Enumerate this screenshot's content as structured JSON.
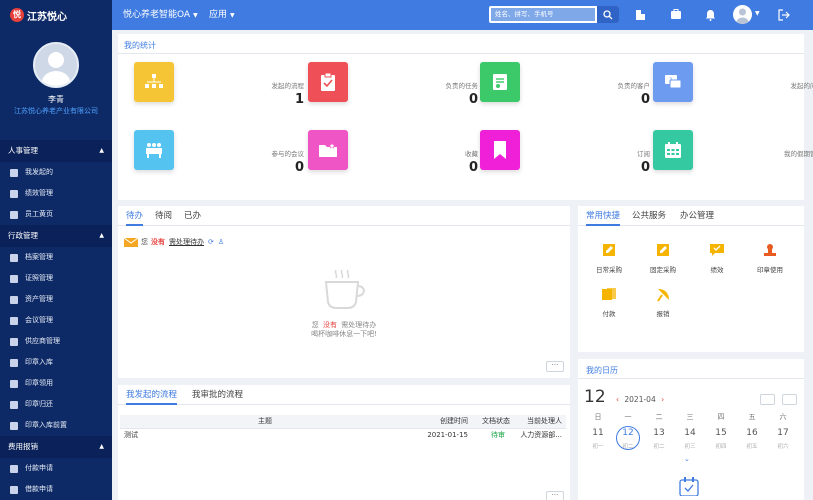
{
  "app": {
    "logo_text": "江苏悦心",
    "logo_mark": "悦"
  },
  "topbar": {
    "menu_oa": "悦心养老智能OA",
    "menu_apps": "应用",
    "search_placeholder": "姓名、拼写、手机号"
  },
  "user": {
    "name": "李青",
    "org": "江苏悦心养老产业有限公司"
  },
  "sidebar": {
    "groups": [
      {
        "title": "人事管理",
        "items": [
          "我发起的",
          "绩效管理",
          "员工黄页"
        ]
      },
      {
        "title": "行政管理",
        "items": [
          "档案管理",
          "证照管理",
          "资产管理",
          "会议管理",
          "供应商管理",
          "印章入库",
          "印章领用",
          "印章归还",
          "印章入库前置"
        ]
      },
      {
        "title": "费用报销",
        "items": [
          "付款申请",
          "借款申请"
        ]
      }
    ]
  },
  "stats": {
    "title": "我的统计",
    "items": [
      {
        "label": "发起的流程",
        "value": "1",
        "color": "#f6c536"
      },
      {
        "label": "负责的任务",
        "value": "0",
        "color": "#ef4f56"
      },
      {
        "label": "负责的客户",
        "value": "0",
        "color": "#3cc96a"
      },
      {
        "label": "发起的问题",
        "value": "0",
        "color": "#6d9bf0"
      },
      {
        "label": "参与的会议",
        "value": "0",
        "color": "#55c3f0"
      },
      {
        "label": "收藏",
        "value": "0",
        "color": "#f055c6"
      },
      {
        "label": "订阅",
        "value": "0",
        "color": "#f020d8"
      },
      {
        "label": "我的假期管理",
        "value": "",
        "color": "#35c9a1"
      }
    ]
  },
  "todo": {
    "tabs": [
      "待办",
      "待阅",
      "已办"
    ],
    "notice_prefix": "您",
    "notice_none": "没有",
    "notice_link": "需处理待办",
    "empty_line1_a": "您",
    "empty_line1_b": "没有",
    "empty_line1_c": "需处理待办",
    "empty_line2": "喝杯咖啡休息一下吧!",
    "more": "···"
  },
  "quick": {
    "tabs": [
      "常用快捷",
      "公共服务",
      "办公管理"
    ],
    "items": [
      "日常采购",
      "固定采购",
      "绩效",
      "印章使用",
      "付款",
      "报销"
    ],
    "colors": [
      "#f5b400",
      "#f5b400",
      "#f5b400",
      "#e85a1f",
      "#f5b400",
      "#f5b400"
    ]
  },
  "flow": {
    "tabs": [
      "我发起的流程",
      "我审批的流程"
    ],
    "columns": [
      "主题",
      "创建时间",
      "文档状态",
      "当前处理人"
    ],
    "rows": [
      {
        "subject": "测试",
        "created": "2021-01-15",
        "status": "待审",
        "handler": "人力资源部..."
      }
    ],
    "status_color": "#19a544",
    "more": "···"
  },
  "calendar": {
    "title": "我的日历",
    "big_day": "12",
    "month": "2021-04",
    "weekdays": [
      "日",
      "一",
      "二",
      "三",
      "四",
      "五",
      "六"
    ],
    "dates": [
      "11",
      "12",
      "13",
      "14",
      "15",
      "16",
      "17"
    ],
    "lunar": [
      "初一",
      "初二",
      "初二",
      "初三",
      "初四",
      "初五",
      "初六"
    ]
  }
}
